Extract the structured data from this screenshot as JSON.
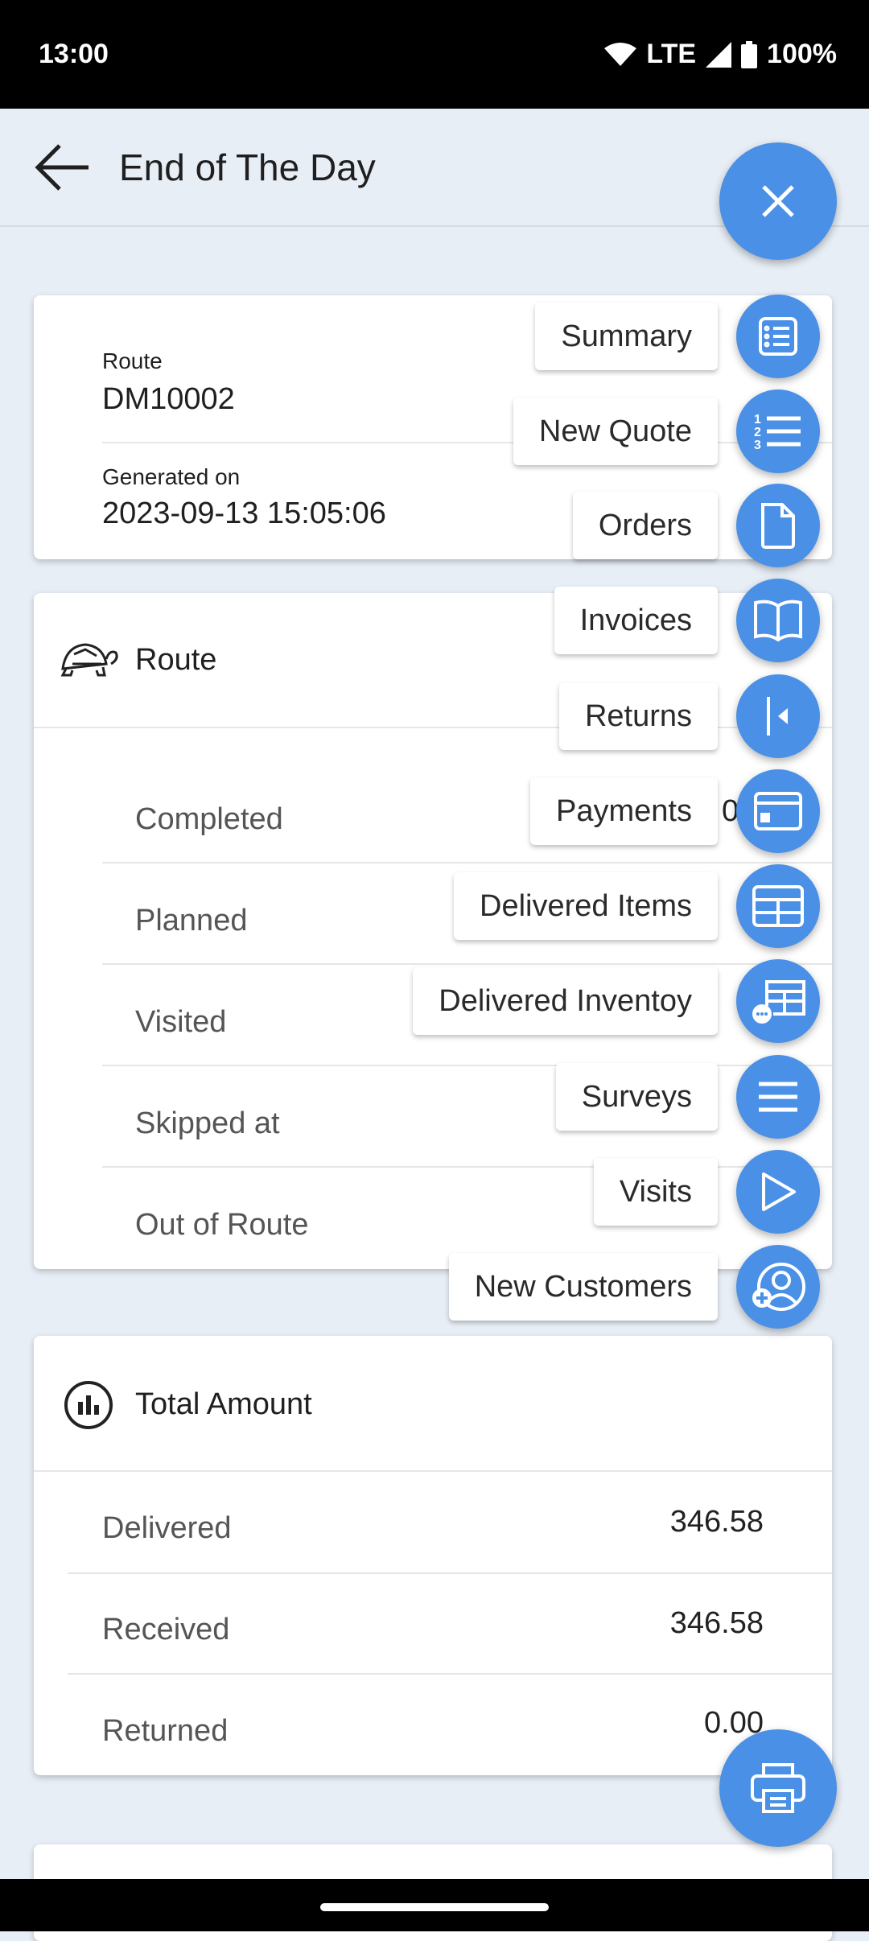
{
  "status_bar": {
    "time": "13:00",
    "network": "LTE",
    "battery": "100%"
  },
  "header": {
    "title": "End of The Day"
  },
  "route_info": {
    "route_label": "Route",
    "route_value": "DM10002",
    "generated_label": "Generated on",
    "generated_value": "2023-09-13 15:05:06"
  },
  "route_card": {
    "title": "Route",
    "icon": "turtle-icon",
    "rows": [
      {
        "label": "Completed",
        "value": "0"
      },
      {
        "label": "Planned"
      },
      {
        "label": "Visited"
      },
      {
        "label": "Skipped at"
      },
      {
        "label": "Out of Route"
      }
    ]
  },
  "total_card": {
    "title": "Total Amount",
    "icon": "bar-chart-circle-icon",
    "rows": [
      {
        "label": "Delivered",
        "value": "346.58"
      },
      {
        "label": "Received",
        "value": "346.58"
      },
      {
        "label": "Returned",
        "value": "0.00"
      }
    ]
  },
  "speed_dial": {
    "items": [
      {
        "label": "Summary",
        "icon": "list-box-icon"
      },
      {
        "label": "New Quote",
        "icon": "numbered-list-icon"
      },
      {
        "label": "Orders",
        "icon": "document-icon"
      },
      {
        "label": "Invoices",
        "icon": "book-icon"
      },
      {
        "label": "Returns",
        "icon": "return-icon"
      },
      {
        "label": "Payments",
        "icon": "card-icon"
      },
      {
        "label": "Delivered Items",
        "icon": "table-icon"
      },
      {
        "label": "Delivered Inventoy",
        "icon": "table-more-icon"
      },
      {
        "label": "Surveys",
        "icon": "menu-icon"
      },
      {
        "label": "Visits",
        "icon": "play-icon"
      },
      {
        "label": "New Customers",
        "icon": "add-user-icon"
      }
    ]
  },
  "colors": {
    "accent": "#4a90e6",
    "background": "#e8eef6"
  }
}
